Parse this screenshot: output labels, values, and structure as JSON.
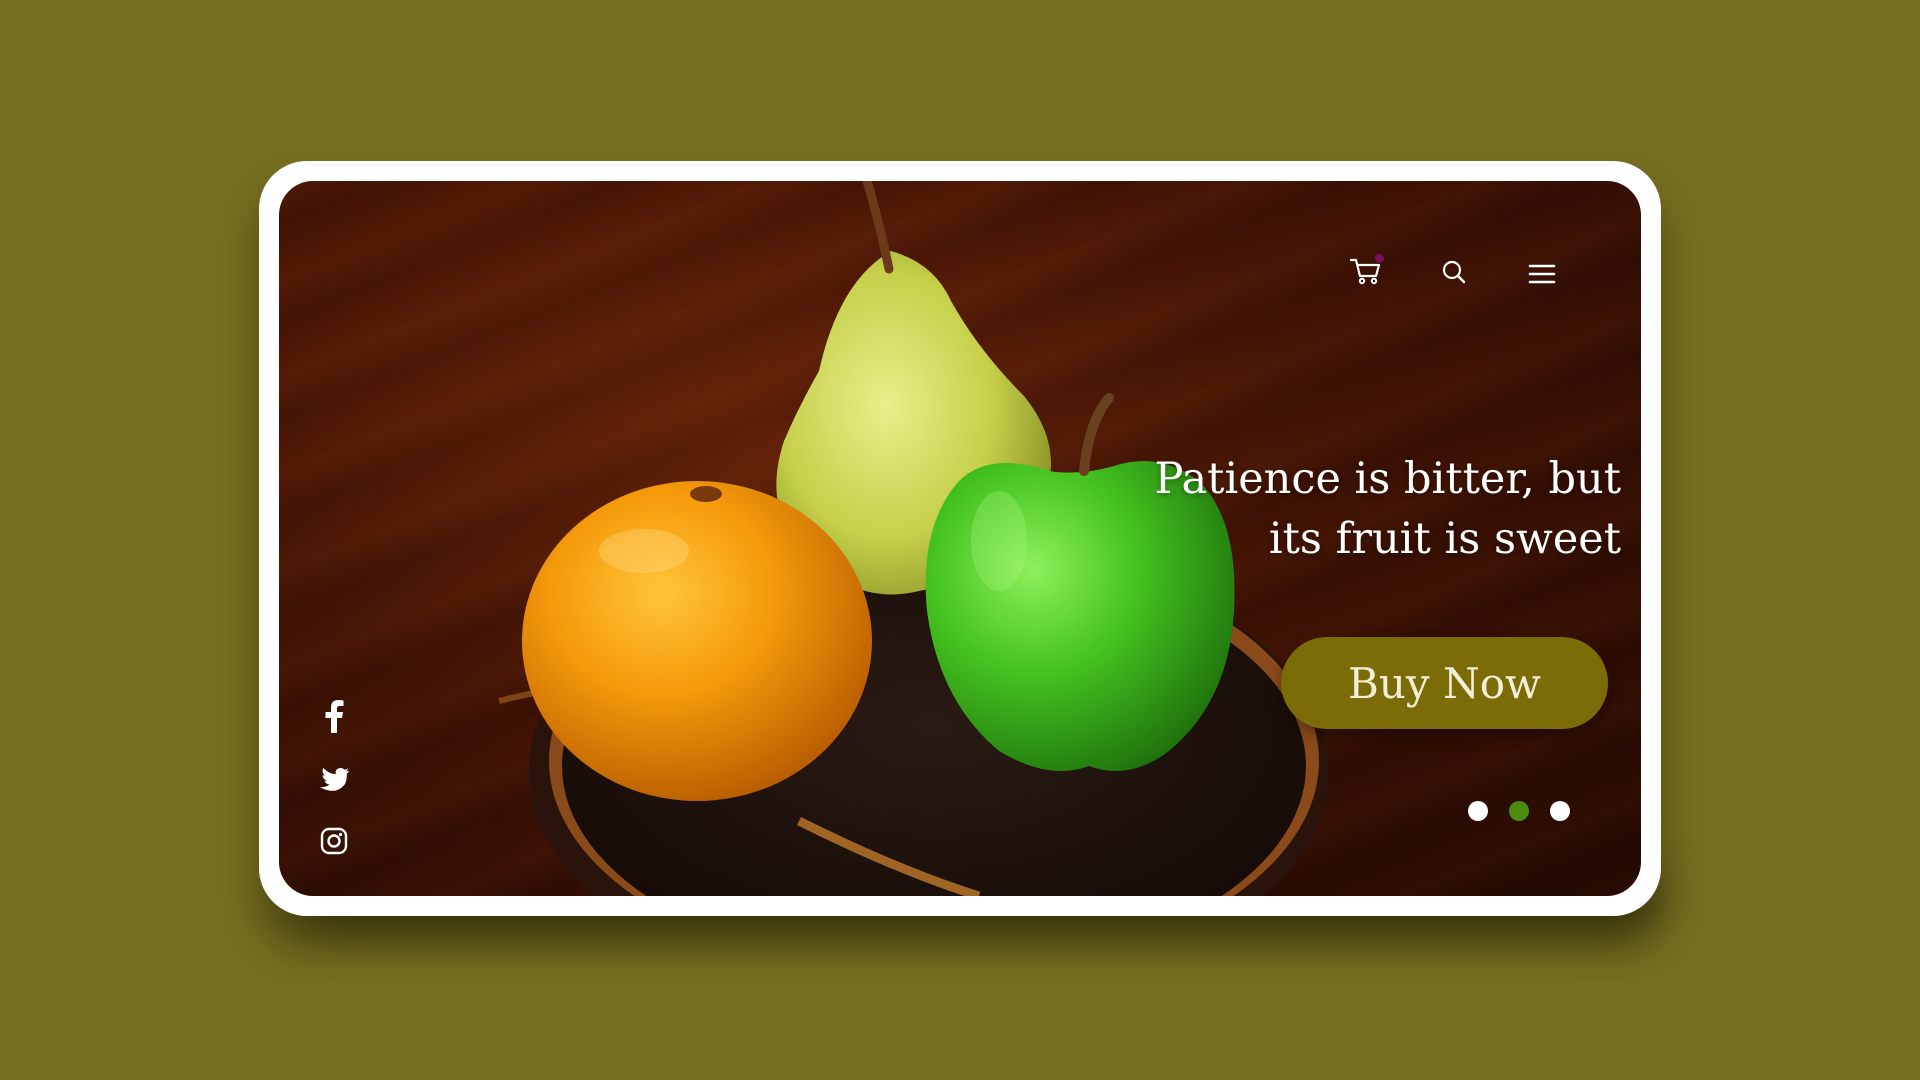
{
  "hero": {
    "headline_line1": "Patience is bitter, but",
    "headline_line2": "its fruit is sweet",
    "cta_label": "Buy Now"
  },
  "nav": {
    "icons": [
      "cart-icon",
      "search-icon",
      "menu-icon"
    ],
    "cart_badge_color": "#7a1060"
  },
  "carousel": {
    "slide_count": 3,
    "active_index": 1,
    "active_color": "#4d8a12",
    "inactive_color": "#ffffff"
  },
  "social": {
    "icons": [
      "facebook-icon",
      "twitter-icon",
      "instagram-icon"
    ]
  },
  "colors": {
    "page_background": "#766e20",
    "button_background": "#7c6c08",
    "button_text": "#f3efd6",
    "frame": "#ffffff"
  }
}
